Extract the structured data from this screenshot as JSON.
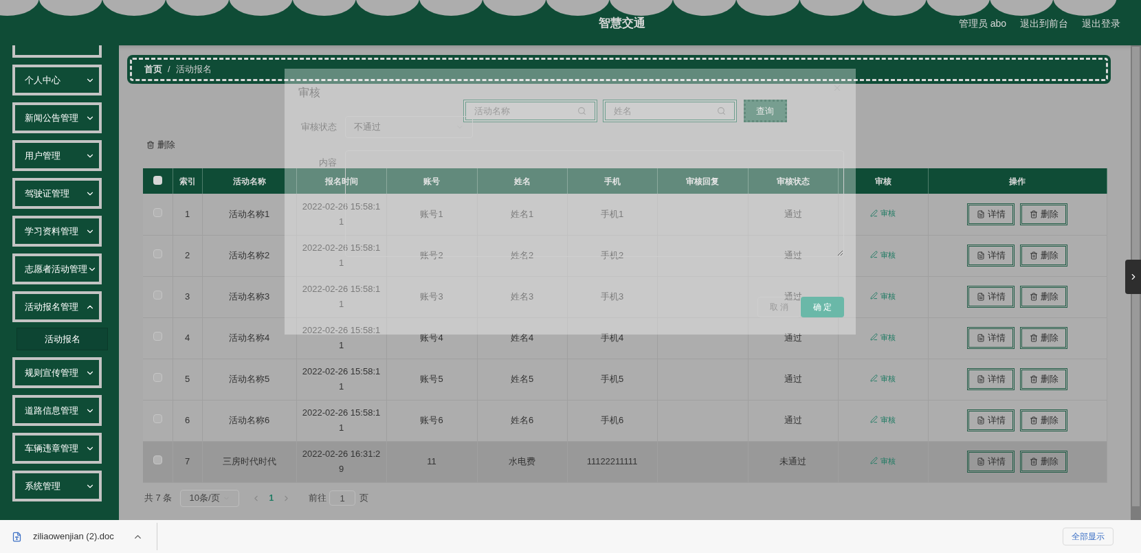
{
  "header": {
    "title": "智慧交通",
    "links": [
      "管理员 abo",
      "退出到前台",
      "退出登录"
    ]
  },
  "sidebar": {
    "items": [
      {
        "label": "个人中心",
        "expanded": false
      },
      {
        "label": "新闻公告管理",
        "expanded": false
      },
      {
        "label": "用户管理",
        "expanded": false
      },
      {
        "label": "驾驶证管理",
        "expanded": false
      },
      {
        "label": "学习资料管理",
        "expanded": false
      },
      {
        "label": "志愿者活动管理",
        "expanded": false
      },
      {
        "label": "活动报名管理",
        "expanded": true,
        "children": [
          {
            "label": "活动报名",
            "selected": true
          }
        ]
      },
      {
        "label": "规则宣传管理",
        "expanded": false
      },
      {
        "label": "道路信息管理",
        "expanded": false
      },
      {
        "label": "车辆违章管理",
        "expanded": false
      },
      {
        "label": "系统管理",
        "expanded": false
      }
    ]
  },
  "breadcrumb": {
    "items": [
      "首页",
      "活动报名"
    ],
    "separator": "/"
  },
  "search": {
    "fields": [
      {
        "placeholder": "活动名称"
      },
      {
        "placeholder": "姓名"
      }
    ],
    "button": "查询"
  },
  "toolbar": {
    "delete": "删除"
  },
  "table": {
    "select_all": {
      "checked": false
    },
    "columns": [
      "索引",
      "活动名称",
      "报名时间",
      "账号",
      "姓名",
      "手机",
      "审核回复",
      "审核状态",
      "审核",
      "操作"
    ],
    "rows": [
      {
        "checked": false,
        "highlighted": false,
        "index": "1",
        "activity": "活动名称1",
        "time": "2022-02-26 15:58:11",
        "account": "账号1",
        "name": "姓名1",
        "phone": "手机1",
        "status": "通过",
        "review": "审核",
        "actions": [
          "详情",
          "删除"
        ]
      },
      {
        "checked": false,
        "highlighted": false,
        "index": "2",
        "activity": "活动名称2",
        "time": "2022-02-26 15:58:11",
        "account": "账号2",
        "name": "姓名2",
        "phone": "手机2",
        "status": "通过",
        "review": "审核",
        "actions": [
          "详情",
          "删除"
        ]
      },
      {
        "checked": false,
        "highlighted": false,
        "index": "3",
        "activity": "活动名称3",
        "time": "2022-02-26 15:58:11",
        "account": "账号3",
        "name": "姓名3",
        "phone": "手机3",
        "status": "通过",
        "review": "审核",
        "actions": [
          "详情",
          "删除"
        ]
      },
      {
        "checked": false,
        "highlighted": false,
        "index": "4",
        "activity": "活动名称4",
        "time": "2022-02-26 15:58:11",
        "account": "账号4",
        "name": "姓名4",
        "phone": "手机4",
        "status": "通过",
        "review": "审核",
        "actions": [
          "详情",
          "删除"
        ]
      },
      {
        "checked": false,
        "highlighted": false,
        "index": "5",
        "activity": "活动名称5",
        "time": "2022-02-26 15:58:11",
        "account": "账号5",
        "name": "姓名5",
        "phone": "手机5",
        "status": "通过",
        "review": "审核",
        "actions": [
          "详情",
          "删除"
        ]
      },
      {
        "checked": false,
        "highlighted": false,
        "index": "6",
        "activity": "活动名称6",
        "time": "2022-02-26 15:58:11",
        "account": "账号6",
        "name": "姓名6",
        "phone": "手机6",
        "status": "通过",
        "review": "审核",
        "actions": [
          "详情",
          "删除"
        ]
      },
      {
        "checked": false,
        "highlighted": true,
        "index": "7",
        "activity": "三房时代时代",
        "time": "2022-02-26 16:31:29",
        "account": "11",
        "name": "水电费",
        "phone": "11122211111",
        "status": "未通过",
        "review": "审核",
        "actions": [
          "详情",
          "删除"
        ]
      }
    ]
  },
  "pagination": {
    "total": "共 7 条",
    "page_size": "10条/页",
    "pages": [
      {
        "label": "1",
        "selected": true
      }
    ],
    "goto_label": "前往",
    "goto_value": "1",
    "page_unit": "页"
  },
  "dialog": {
    "title": "审核",
    "fields": [
      {
        "kind": "select",
        "label": "审核状态",
        "value": "不通过"
      },
      {
        "kind": "textarea",
        "label": "内容"
      }
    ],
    "buttons": [
      {
        "kind": "cancel",
        "label": "取 消"
      },
      {
        "kind": "confirm",
        "label": "确 定"
      }
    ]
  },
  "download_bar": {
    "file": "ziliaowenjian (2).doc",
    "show_all": "全部显示"
  }
}
